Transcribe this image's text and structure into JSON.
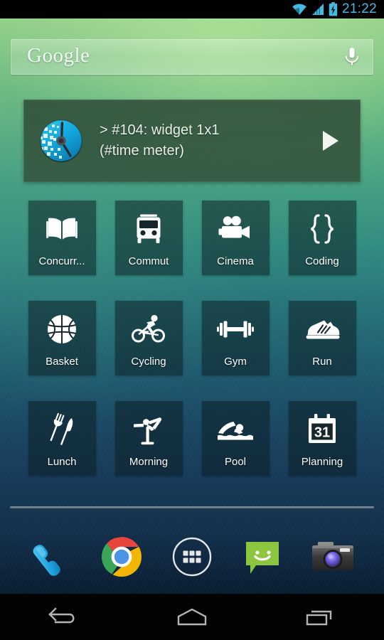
{
  "statusbar": {
    "time": "21:22",
    "icons": [
      "wifi-icon",
      "cellular-signal-icon",
      "battery-charging-icon"
    ],
    "accent_color": "#45b9e0"
  },
  "search": {
    "brand": "Google",
    "mic_icon": "microphone-icon"
  },
  "widget": {
    "icon": "time-meter-clock-icon",
    "line1": "> #104: widget 1x1",
    "line2": "(#time meter)",
    "play_icon": "play-icon",
    "background_color": "#304e38"
  },
  "grid": {
    "tiles": [
      {
        "label": "Concurr...",
        "icon": "book-icon"
      },
      {
        "label": "Commut",
        "icon": "bus-icon"
      },
      {
        "label": "Cinema",
        "icon": "movie-camera-icon"
      },
      {
        "label": "Coding",
        "icon": "curly-braces-icon"
      },
      {
        "label": "Basket",
        "icon": "basketball-icon"
      },
      {
        "label": "Cycling",
        "icon": "cyclist-icon"
      },
      {
        "label": "Gym",
        "icon": "dumbbell-icon"
      },
      {
        "label": "Run",
        "icon": "sneaker-icon"
      },
      {
        "label": "Lunch",
        "icon": "fork-knife-icon"
      },
      {
        "label": "Morning",
        "icon": "yoga-pose-icon"
      },
      {
        "label": "Pool",
        "icon": "swimmer-icon"
      },
      {
        "label": "Planning",
        "icon": "calendar-31-icon"
      }
    ],
    "calendar_day": "31",
    "tile_color": "#0c1c20"
  },
  "dock": {
    "items": [
      {
        "name": "phone",
        "icon": "phone-handset-icon"
      },
      {
        "name": "chrome",
        "icon": "chrome-browser-icon"
      },
      {
        "name": "app-drawer",
        "icon": "apps-grid-icon"
      },
      {
        "name": "messaging",
        "icon": "messaging-bubble-icon"
      },
      {
        "name": "camera",
        "icon": "camera-icon"
      }
    ]
  },
  "navbar": {
    "buttons": [
      {
        "name": "back",
        "icon": "back-arrow-icon"
      },
      {
        "name": "home",
        "icon": "home-icon"
      },
      {
        "name": "recents",
        "icon": "recents-icon"
      }
    ]
  },
  "wallpaper": {
    "top_color": "#93d089",
    "bottom_color": "#091c31"
  }
}
